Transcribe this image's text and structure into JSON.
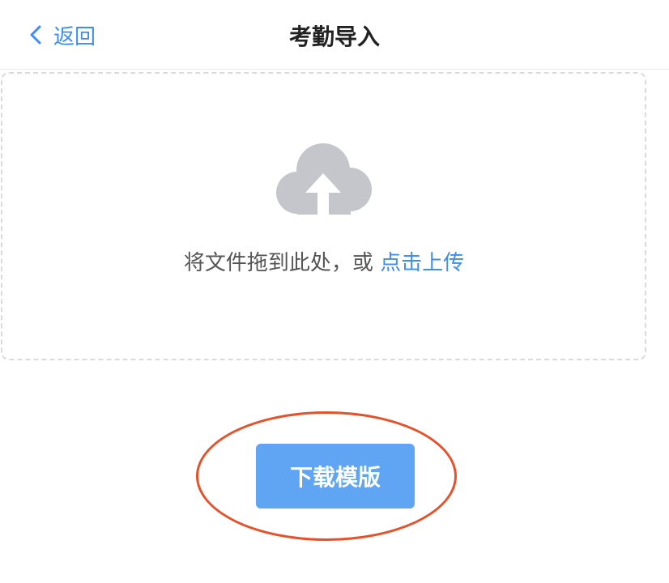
{
  "nav": {
    "back_label": "返回",
    "title": "考勤导入"
  },
  "upload": {
    "drop_text": "将文件拖到此处，或",
    "upload_link": "点击上传"
  },
  "download": {
    "label": "下载模版"
  },
  "colors": {
    "accent": "#3d8ef2",
    "button": "#5fa5f3",
    "highlight_ring": "#e8502a",
    "cloud_icon": "#c4c6cb"
  },
  "icons": {
    "back": "chevron-left-icon",
    "upload": "cloud-upload-icon"
  }
}
